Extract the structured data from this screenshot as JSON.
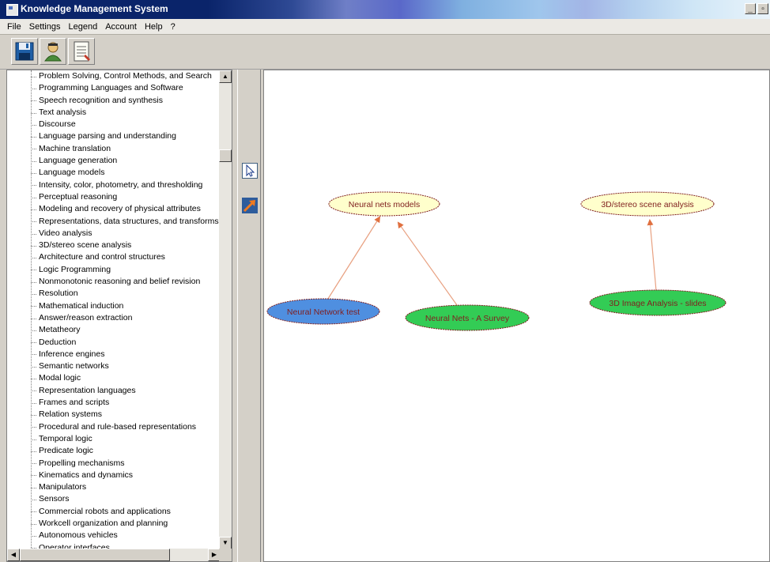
{
  "window": {
    "title": "Knowledge Management System"
  },
  "menu": [
    "File",
    "Settings",
    "Legend",
    "Account",
    "Help",
    "?"
  ],
  "toolbar": [
    {
      "icon": "save-disk-icon"
    },
    {
      "icon": "user-figure-icon"
    },
    {
      "icon": "document-icon"
    }
  ],
  "tree": {
    "items": [
      "Problem Solving, Control Methods, and Search",
      "Programming Languages and Software",
      "Speech recognition and synthesis",
      "Text analysis",
      "Discourse",
      "Language parsing and understanding",
      "Machine translation",
      "Language generation",
      "Language models",
      "Intensity, color, photometry, and thresholding",
      "Perceptual reasoning",
      "Modeling and recovery of physical attributes",
      "Representations, data structures, and transforms",
      "Video analysis",
      "3D/stereo scene analysis",
      "Architecture and control structures",
      "Logic Programming",
      "Nonmonotonic reasoning and belief revision",
      "Resolution",
      "Mathematical induction",
      "Answer/reason extraction",
      "Metatheory",
      "Deduction",
      "Inference engines",
      "Semantic networks",
      "Modal logic",
      "Representation languages",
      "Frames and scripts",
      "Relation systems",
      "Procedural and rule-based representations",
      "Temporal logic",
      "Predicate logic",
      "Propelling mechanisms",
      "Kinematics and dynamics",
      "Manipulators",
      "Sensors",
      "Commercial robots and applications",
      "Workcell organization and planning",
      "Autonomous vehicles",
      "Operator interfaces"
    ]
  },
  "palette": [
    {
      "icon": "pointer-arrow-icon"
    },
    {
      "icon": "connector-arrow-icon"
    }
  ],
  "graph": {
    "nodes": [
      {
        "id": "n1",
        "label": "Neural nets models",
        "color": "#ffffcc"
      },
      {
        "id": "n2",
        "label": "3D/stereo scene analysis",
        "color": "#ffffcc"
      },
      {
        "id": "n3",
        "label": "Neural Network test",
        "color": "#4f8fe0"
      },
      {
        "id": "n4",
        "label": "Neural Nets - A Survey",
        "color": "#33cc55"
      },
      {
        "id": "n5",
        "label": "3D Image Analysis - slides",
        "color": "#33cc55"
      }
    ],
    "edges": [
      {
        "from": "n3",
        "to": "n1"
      },
      {
        "from": "n4",
        "to": "n1"
      },
      {
        "from": "n5",
        "to": "n2"
      }
    ],
    "edge_color": "#e8a080"
  }
}
